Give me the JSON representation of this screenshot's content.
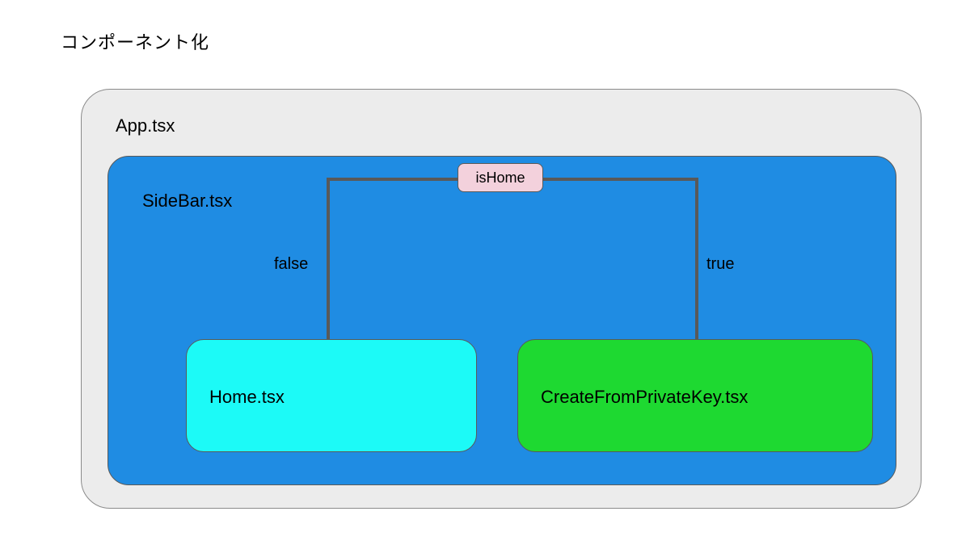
{
  "heading": "コンポーネント化",
  "app": {
    "label": "App.tsx"
  },
  "sidebar": {
    "label": "SideBar.tsx"
  },
  "condition": {
    "badge": "isHome",
    "false_label": "false",
    "true_label": "true"
  },
  "home": {
    "label": "Home.tsx"
  },
  "create": {
    "label": "CreateFromPrivateKey.tsx"
  }
}
